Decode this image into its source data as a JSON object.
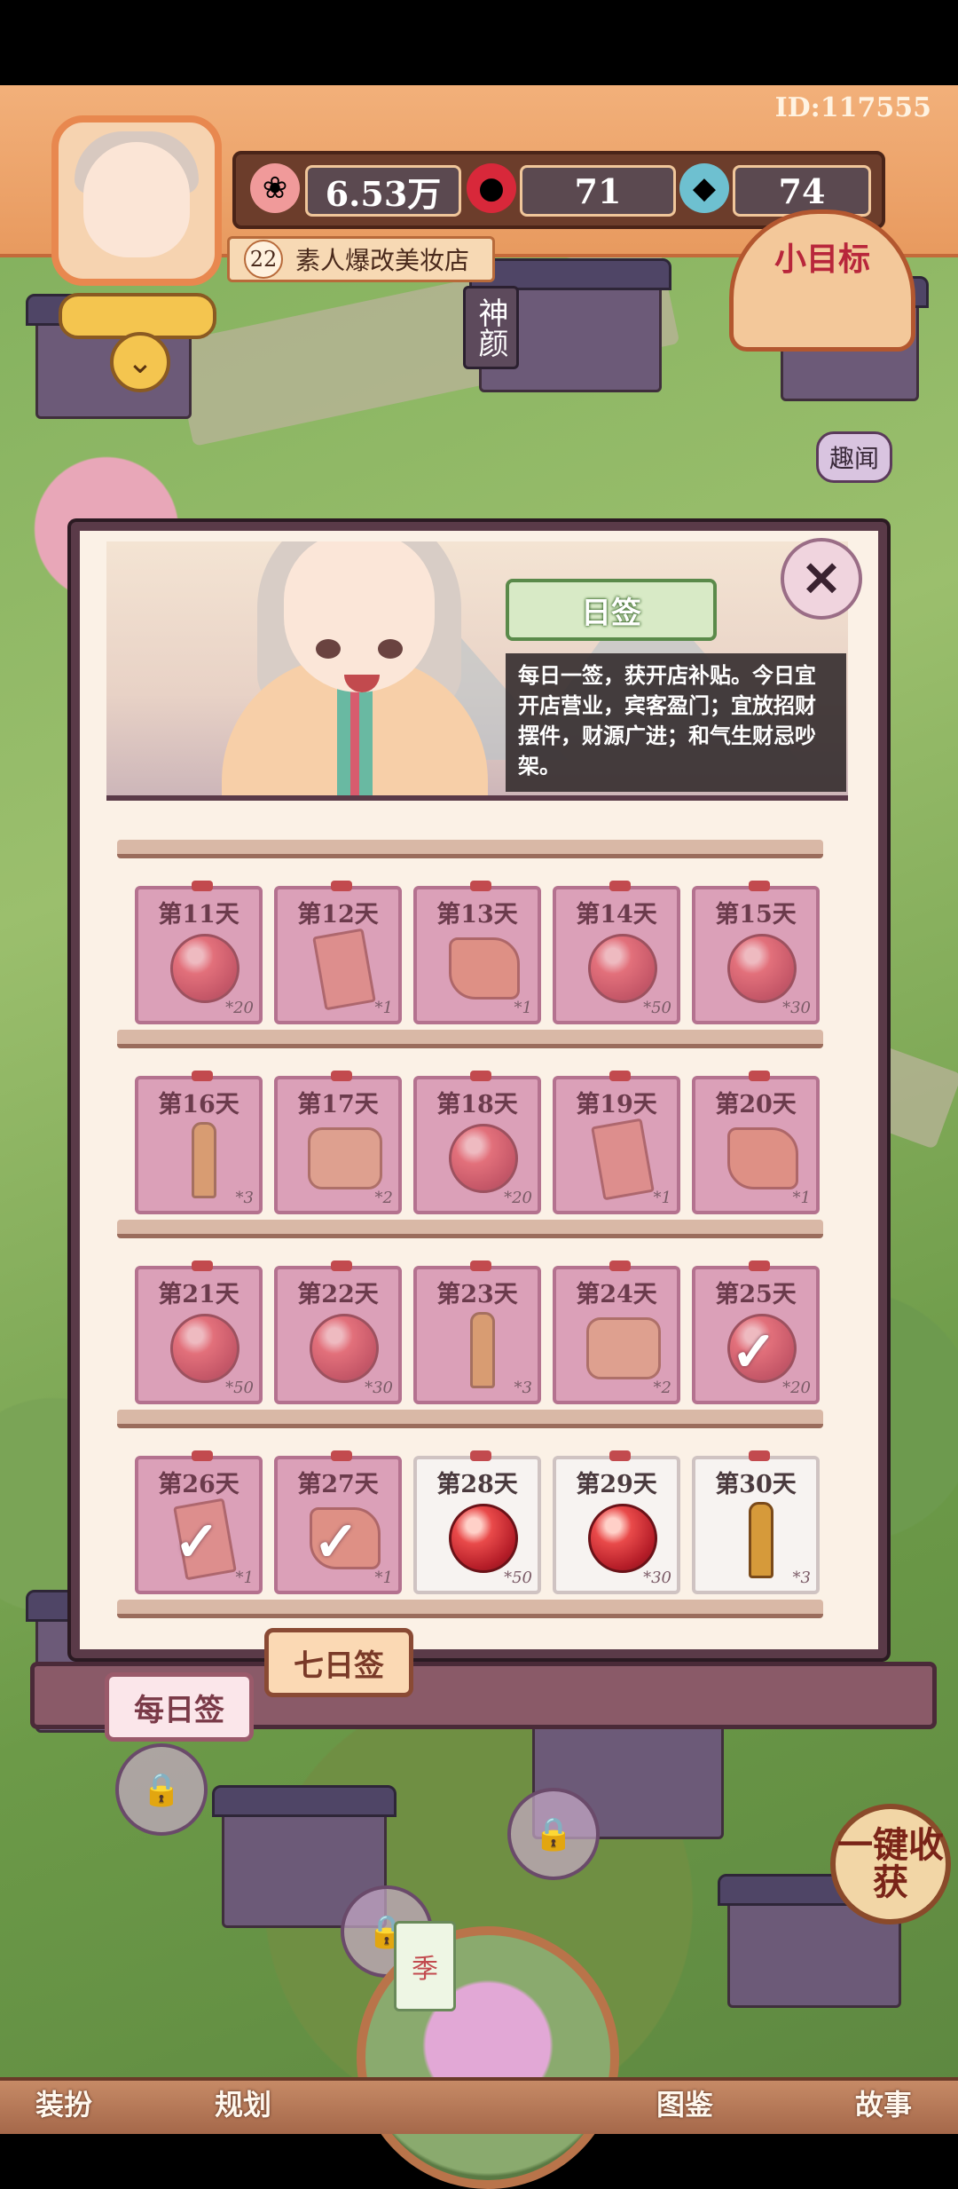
{
  "header": {
    "player_id": "ID:117555",
    "level": "22",
    "shop_name": "素人爆改美妆店",
    "goal_label": "小目标"
  },
  "resources": [
    {
      "icon": "coin-icon",
      "value": "6.53万"
    },
    {
      "icon": "red-orb-icon",
      "value": "71"
    },
    {
      "icon": "blue-gem-icon",
      "value": "74"
    }
  ],
  "map_labels": {
    "shen_yan": "神颜",
    "qu_wen": "趣闻"
  },
  "signin": {
    "tag": "日签",
    "description": "每日一签，获开店补贴。今日宜开店营业，宾客盈门；宜放招财摆件，财源广进；和气生财忌吵架。",
    "close_icon": "close-icon"
  },
  "rewards": [
    {
      "day": "第11天",
      "item": "orb",
      "count": "*20",
      "claimed": true
    },
    {
      "day": "第12天",
      "item": "ticket",
      "count": "*1",
      "claimed": true
    },
    {
      "day": "第13天",
      "item": "scroll",
      "count": "*1",
      "claimed": true
    },
    {
      "day": "第14天",
      "item": "orb",
      "count": "*50",
      "claimed": true
    },
    {
      "day": "第15天",
      "item": "orb",
      "count": "*30",
      "claimed": true
    },
    {
      "day": "第16天",
      "item": "arrow",
      "count": "*3",
      "claimed": true
    },
    {
      "day": "第17天",
      "item": "bundle",
      "count": "*2",
      "claimed": true
    },
    {
      "day": "第18天",
      "item": "orb",
      "count": "*20",
      "claimed": true
    },
    {
      "day": "第19天",
      "item": "ticket",
      "count": "*1",
      "claimed": true
    },
    {
      "day": "第20天",
      "item": "scroll",
      "count": "*1",
      "claimed": true
    },
    {
      "day": "第21天",
      "item": "orb",
      "count": "*50",
      "claimed": true
    },
    {
      "day": "第22天",
      "item": "orb",
      "count": "*30",
      "claimed": true
    },
    {
      "day": "第23天",
      "item": "arrow",
      "count": "*3",
      "claimed": true
    },
    {
      "day": "第24天",
      "item": "bundle",
      "count": "*2",
      "claimed": true
    },
    {
      "day": "第25天",
      "item": "orb",
      "count": "*20",
      "claimed": true,
      "checked": true
    },
    {
      "day": "第26天",
      "item": "ticket",
      "count": "*1",
      "claimed": true,
      "checked": true
    },
    {
      "day": "第27天",
      "item": "scroll",
      "count": "*1",
      "claimed": true,
      "checked": true
    },
    {
      "day": "第28天",
      "item": "orb",
      "count": "*50",
      "claimed": false
    },
    {
      "day": "第29天",
      "item": "orb",
      "count": "*30",
      "claimed": false
    },
    {
      "day": "第30天",
      "item": "arrow",
      "count": "*3",
      "claimed": false
    }
  ],
  "tabs": {
    "daily": "每日签",
    "seven_day": "七日签"
  },
  "harvest_label": "一键收获",
  "season_label": "季",
  "bottom_nav": [
    "装扮",
    "规划",
    "图鉴",
    "故事"
  ],
  "colors": {
    "hud": "#e89a5f",
    "card_claimed": "#dba0b8",
    "card_open": "#f7f3f1",
    "panel_frame": "#5a3a48"
  }
}
